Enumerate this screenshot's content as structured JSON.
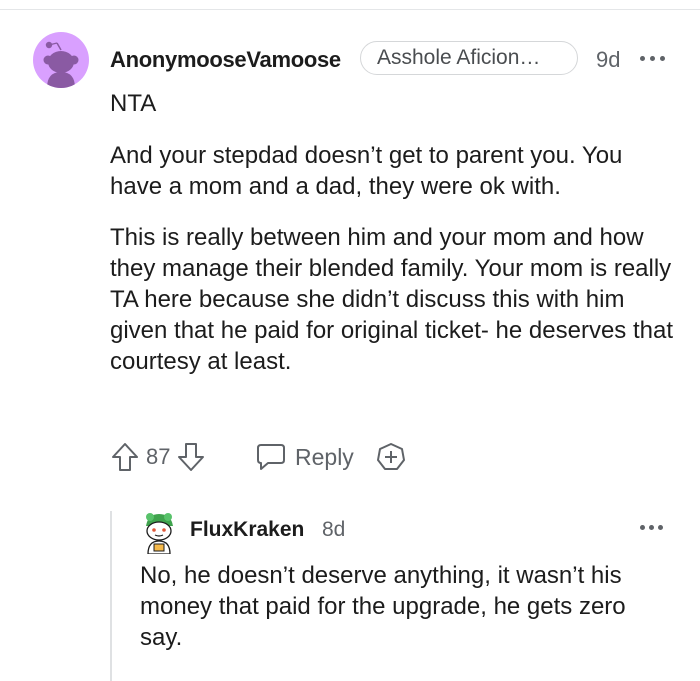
{
  "comment": {
    "username": "AnonymooseVamoose",
    "flair": "Asshole Aficion…",
    "age": "9d",
    "paragraphs": [
      "NTA",
      "And your stepdad doesn’t get to parent you. You have a mom and a dad, they were ok with.",
      "This is really between him and your mom and how they manage their blended family. Your mom is really TA here because she didn’t discuss this with him given that he paid for original ticket- he deserves that courtesy at least."
    ],
    "score": "87",
    "reply_label": "Reply",
    "icons": {
      "avatar": "reddit-snoo-avatar",
      "upvote": "arrow-up-icon",
      "downvote": "arrow-down-icon",
      "reply": "speech-bubble-icon",
      "award": "award-plus-icon",
      "more": "more-dots-icon"
    },
    "avatar_color": "#d9a0ff"
  },
  "reply": {
    "username": "FluxKraken",
    "age": "8d",
    "text": "No, he doesn’t deserve anything, it wasn’t his money that paid for the upgrade, he gets zero say.",
    "icons": {
      "avatar": "reddit-snoo-avatar",
      "more": "more-dots-icon"
    }
  }
}
